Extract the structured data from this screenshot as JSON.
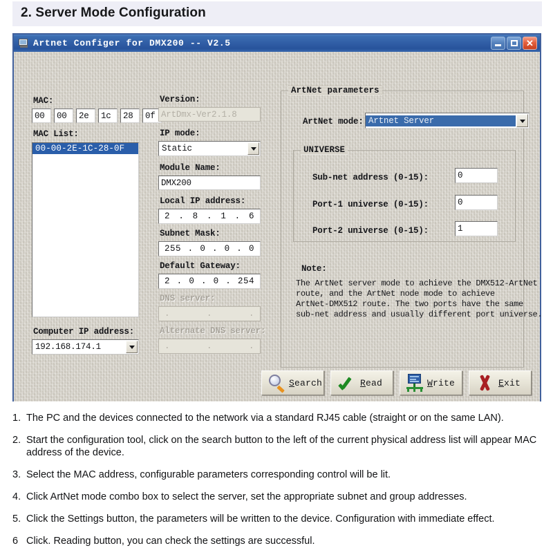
{
  "header": {
    "title": "2. Server Mode Configuration"
  },
  "window": {
    "title": "Artnet Configer for DMX200 -- V2.5",
    "icon": "monitor-icon",
    "controls": {
      "minimize": "_",
      "maximize": "□",
      "close": "×"
    }
  },
  "left_panel": {
    "mac_label": "MAC:",
    "mac_octets": [
      "00",
      "00",
      "2e",
      "1c",
      "28",
      "0f"
    ],
    "mac_list_label": "MAC List:",
    "mac_list_items": [
      "00-00-2E-1C-28-0F"
    ],
    "computer_ip_label": "Computer IP address:",
    "computer_ip_value": "192.168.174.1"
  },
  "middle_panel": {
    "version_label": "Version:",
    "version_value": "ArtDmx-Ver2.1.8",
    "ip_mode_label": "IP mode:",
    "ip_mode_value": "Static",
    "module_name_label": "Module Name:",
    "module_name_value": "DMX200",
    "local_ip_label": "Local IP address:",
    "local_ip_octets": [
      "2",
      "8",
      "1",
      "6"
    ],
    "subnet_mask_label": "Subnet Mask:",
    "subnet_mask_octets": [
      "255",
      "0",
      "0",
      "0"
    ],
    "default_gateway_label": "Default Gateway:",
    "default_gateway_octets": [
      "2",
      "0",
      "0",
      "254"
    ],
    "dns_server_label": "DNS server:",
    "dns_server_octets": [
      ".",
      ".",
      "."
    ],
    "alt_dns_server_label": "Alternate DNS server:",
    "alt_dns_server_octets": [
      ".",
      ".",
      "."
    ]
  },
  "right_panel": {
    "group_title": "ArtNet parameters",
    "artnet_mode_label": "ArtNet mode:",
    "artnet_mode_value": "Artnet Server",
    "universe_group_title": "UNIVERSE",
    "subnet_address_label": "Sub-net address (0-15):",
    "subnet_address_value": "0",
    "port1_universe_label": "Port-1 universe (0-15):",
    "port1_universe_value": "0",
    "port2_universe_label": "Port-2 universe (0-15):",
    "port2_universe_value": "1",
    "note_label": "Note:",
    "note_text": "The ArtNet server mode to achieve the DMX512-ArtNet\nroute, and the ArtNet node mode to achieve\nArtNet-DMX512 route. The two ports have the same\nsub-net address and usually different port universe."
  },
  "buttons": [
    {
      "name": "search",
      "label_pre": "",
      "label_accel": "S",
      "label_post": "earch",
      "icon": "magnifier-icon"
    },
    {
      "name": "read",
      "label_pre": "",
      "label_accel": "R",
      "label_post": "ead",
      "icon": "green-check-icon"
    },
    {
      "name": "write",
      "label_pre": "",
      "label_accel": "W",
      "label_post": "rite",
      "icon": "device-write-icon"
    },
    {
      "name": "exit",
      "label_pre": "",
      "label_accel": "E",
      "label_post": "xit",
      "icon": "red-x-icon"
    }
  ],
  "instructions": [
    {
      "num": "1.",
      "text": "The PC and the devices connected to the network via a standard RJ45 cable (straight or on the same LAN)."
    },
    {
      "num": "2.",
      "text": "Start the configuration tool, click on the search button to the left of the current physical address list will appear MAC address of the device."
    },
    {
      "num": "3.",
      "text": "Select the MAC address, configurable parameters corresponding control will be lit."
    },
    {
      "num": "4.",
      "text": "Click  ArtNet mode combo box to select the server, set the appropriate subnet and group addresses."
    },
    {
      "num": "5.",
      "text": "Click the Settings button, the parameters will be written to the device. Configuration with immediate effect."
    },
    {
      "num": "6",
      "text": "Click. Reading button, you can check the settings are successful."
    }
  ],
  "colors": {
    "titlebar_blue": "#2f5ca4",
    "dialog_border": "#41609c",
    "dialog_face": "#d9d5cb",
    "selection_blue": "#2a5eaa",
    "combo_selection": "#3a6bab",
    "banner": "#eeeef6"
  }
}
